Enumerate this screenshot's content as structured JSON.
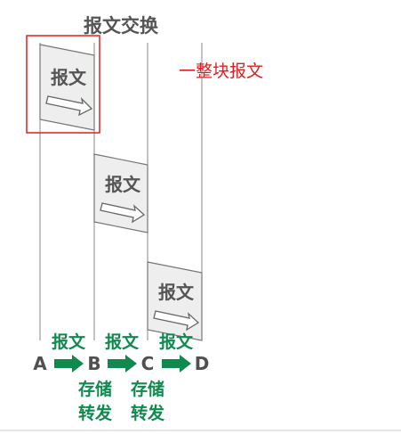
{
  "title": "报文交换",
  "annotation": "一整块报文",
  "packet_label": "报文",
  "nodes": [
    "A",
    "B",
    "C",
    "D"
  ],
  "hop_labels": [
    "报文",
    "报文",
    "报文"
  ],
  "store_forward": [
    {
      "line1": "存储",
      "line2": "转发"
    },
    {
      "line1": "存储",
      "line2": "转发"
    }
  ],
  "colors": {
    "title": "#555555",
    "annotation": "#e02020",
    "highlight_box": "#e02020",
    "green": "#0e8a4e",
    "packet_fill": "#eeeeee",
    "packet_stroke": "#777777",
    "timeline": "#888888"
  }
}
